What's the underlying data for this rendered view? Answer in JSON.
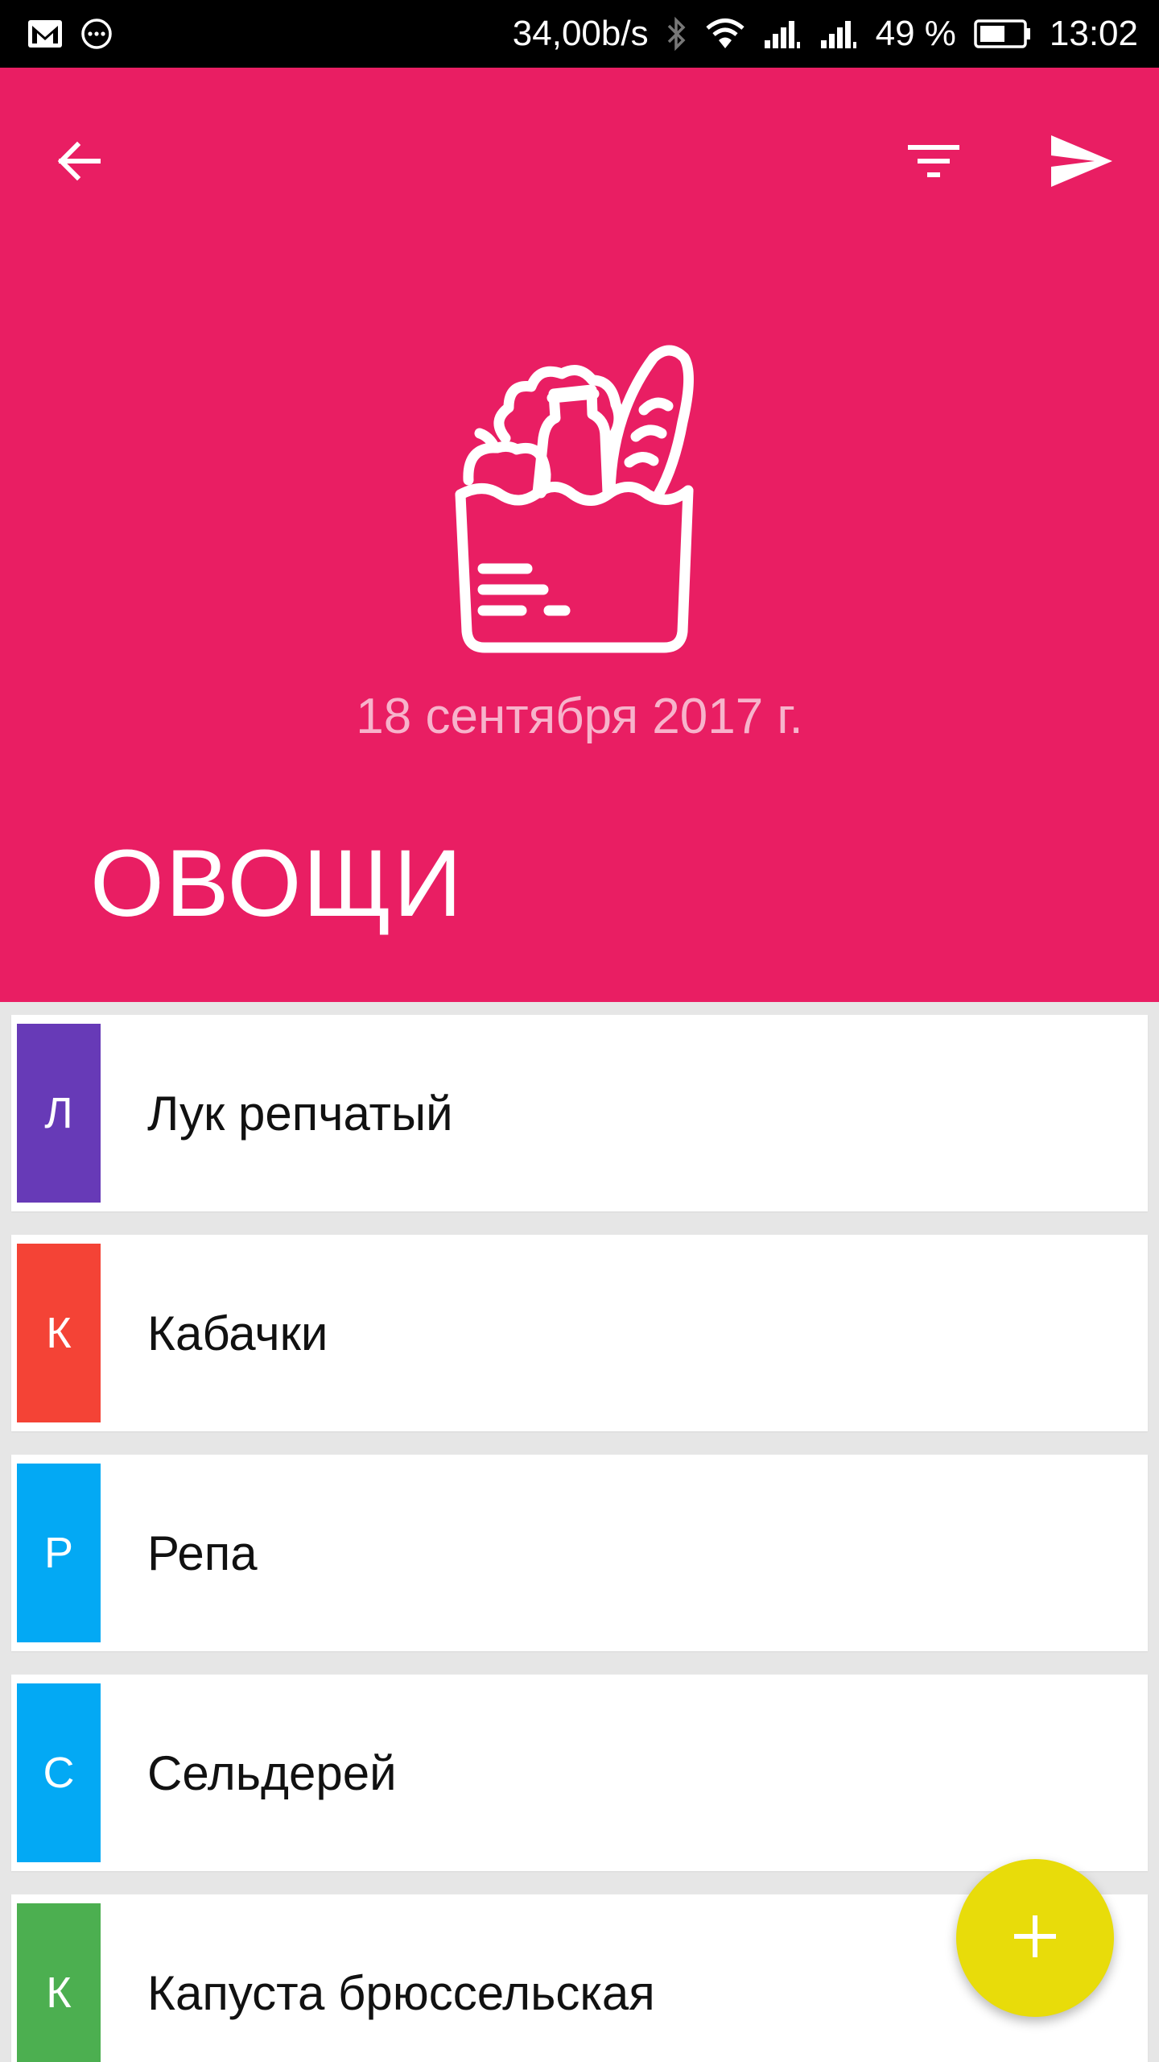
{
  "status_bar": {
    "speed": "34,00b/s",
    "battery_percent": "49 %",
    "time": "13:02",
    "icons": [
      "gmail-icon",
      "chat-icon",
      "bluetooth-icon",
      "wifi-icon",
      "signal-icon",
      "signal-icon",
      "battery-icon"
    ]
  },
  "toolbar": {
    "back_icon": "arrow-back-icon",
    "filter_icon": "filter-icon",
    "send_icon": "send-icon"
  },
  "header": {
    "icon": "grocery-bag-icon",
    "date": "18 сентября 2017 г.",
    "title": "ОВОЩИ",
    "background_color": "#e91e63"
  },
  "items": [
    {
      "letter": "Л",
      "label": "Лук репчатый",
      "color": "#673ab7"
    },
    {
      "letter": "К",
      "label": "Кабачки",
      "color": "#f44336"
    },
    {
      "letter": "Р",
      "label": "Репа",
      "color": "#03a9f4"
    },
    {
      "letter": "С",
      "label": "Сельдерей",
      "color": "#03a9f4"
    },
    {
      "letter": "К",
      "label": "Капуста брюссельская",
      "color": "#4caf50"
    }
  ],
  "fab": {
    "icon": "plus-icon",
    "color": "#e8dc0a"
  }
}
